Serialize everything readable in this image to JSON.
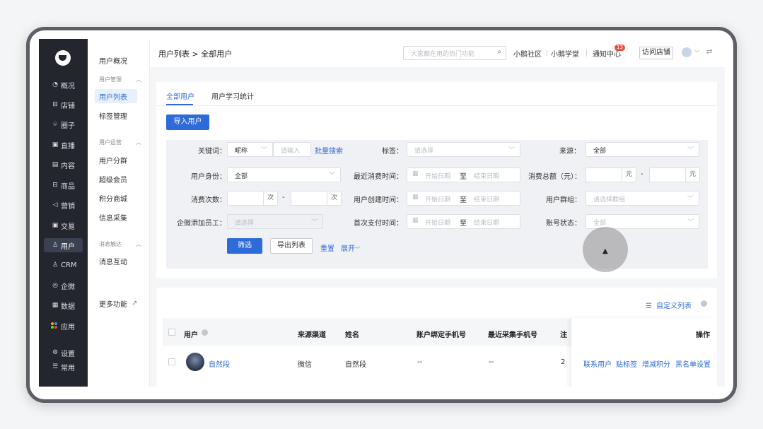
{
  "nav": {
    "items": [
      {
        "icon": "pie-chart-icon",
        "glyph": "◔",
        "label": "概况"
      },
      {
        "icon": "store-icon",
        "glyph": "⊟",
        "label": "店铺"
      },
      {
        "icon": "circle-group-icon",
        "glyph": "♧",
        "label": "圈子"
      },
      {
        "icon": "live-icon",
        "glyph": "▣",
        "label": "直播"
      },
      {
        "icon": "document-icon",
        "glyph": "▤",
        "label": "内容"
      },
      {
        "icon": "goods-icon",
        "glyph": "⊟",
        "label": "商品"
      },
      {
        "icon": "marketing-icon",
        "glyph": "◁",
        "label": "营销"
      },
      {
        "icon": "trade-icon",
        "glyph": "▣",
        "label": "交易"
      },
      {
        "icon": "user-icon",
        "glyph": "♙",
        "label": "用户"
      },
      {
        "icon": "crm-icon",
        "glyph": "♙",
        "label": "CRM"
      },
      {
        "icon": "wecom-icon",
        "glyph": "◎",
        "label": "企微"
      },
      {
        "icon": "data-icon",
        "glyph": "▦",
        "label": "数据"
      },
      {
        "icon": "apps-icon",
        "glyph": "",
        "label": "应用"
      },
      {
        "icon": "settings-icon",
        "glyph": "⚙",
        "label": "设置"
      },
      {
        "icon": "menu-icon",
        "glyph": "☰",
        "label": "常用"
      }
    ]
  },
  "sub": {
    "overview": "用户概况",
    "group_manage": "用户管理",
    "user_list": "用户列表",
    "tag_manage": "标签管理",
    "group_ops": "用户运营",
    "segments": "用户分群",
    "vip": "超级会员",
    "points_mall": "积分商城",
    "info_collect": "信息采集",
    "group_msg": "消息触达",
    "msg_interact": "消息互动",
    "more": "更多功能"
  },
  "topbar": {
    "breadcrumb": "用户列表 > 全部用户",
    "search_placeholder": "大家都在用的热门功能",
    "community": "小鹅社区",
    "academy": "小鹅学堂",
    "notice": "通知中心",
    "notice_count": "13",
    "visit_store": "访问店铺"
  },
  "tabs": {
    "all": "全部用户",
    "study": "用户学习统计"
  },
  "import_button": "导入用户",
  "filters": {
    "keyword_label": "关键词：",
    "keyword_type": "昵称",
    "keyword_placeholder": "请输入",
    "batch_search": "批量搜索",
    "tag_label": "标签：",
    "tag_placeholder": "请选择",
    "source_label": "来源：",
    "source_value": "全部",
    "identity_label": "用户身份：",
    "identity_value": "全部",
    "last_consume_label": "最近消费时间：",
    "start_date": "开始日期",
    "to": "至",
    "end_date": "结束日期",
    "total_label": "消费总额（元）：",
    "yuan": "元",
    "count_label": "消费次数：",
    "times": "次",
    "created_label": "用户创建时间：",
    "group_label": "用户群组：",
    "group_placeholder": "请选择群组",
    "staff_label": "企微添加员工：",
    "staff_placeholder": "请选择",
    "first_pay_label": "首次支付时间：",
    "account_label": "账号状态：",
    "account_value": "全部",
    "filter_button": "筛选",
    "export_button": "导出列表",
    "reset": "重置",
    "expand": "展开"
  },
  "table": {
    "custom_columns": "自定义列表",
    "headers": [
      "用户",
      "来源渠道",
      "姓名",
      "账户绑定手机号",
      "最近采集手机号",
      "注",
      "操作"
    ],
    "rows": [
      {
        "nickname": "自然段",
        "channel": "微信",
        "name": "自然段",
        "bound_phone": "--",
        "collected_phone": "--",
        "extra": "2"
      }
    ],
    "ops": [
      "联系用户",
      "贴标签",
      "增减积分",
      "黑名单设置"
    ]
  },
  "colors": {
    "accent": "#2f6bd8",
    "nav_bg": "#23262d",
    "badge": "#f04b3c"
  }
}
